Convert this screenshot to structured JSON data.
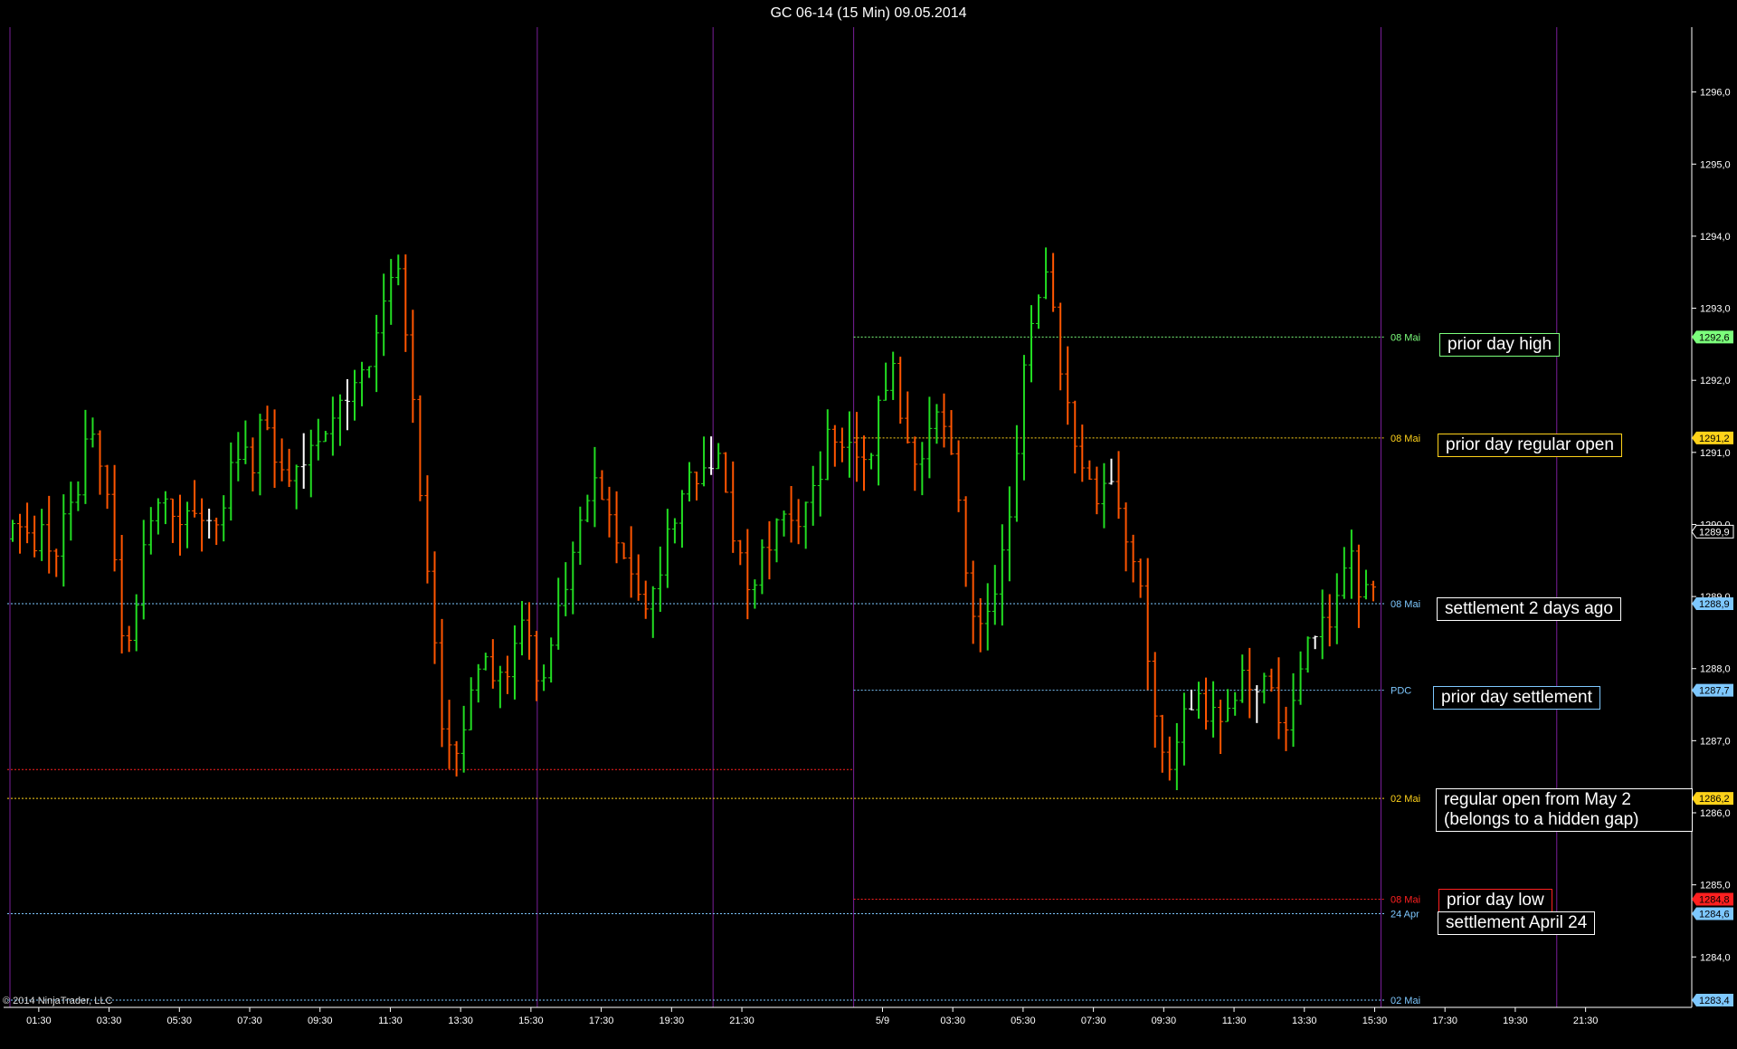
{
  "window": {
    "title": "GC 06-14 (15 Min)  09.05.2014"
  },
  "copyright": "© 2014 NinjaTrader, LLC",
  "colors": {
    "background": "#000000",
    "up_bar": "#22dd22",
    "down_bar": "#ff5500",
    "neutral_bar": "#ffffff",
    "session_line": "#7a1f9a",
    "prior_high": "#7cff7c",
    "regular_open": "#ffd21a",
    "settlement": "#7ec8ff",
    "prior_low": "#ff2020"
  },
  "annotations": [
    {
      "id": "prior-day-high",
      "text": "prior day high",
      "border": "#7cff7c"
    },
    {
      "id": "prior-day-regular-open",
      "text": "prior day regular open",
      "border": "#ffd21a"
    },
    {
      "id": "settlement-2-days-ago",
      "text": "settlement 2 days ago",
      "border": "#ffffff"
    },
    {
      "id": "prior-day-settlement",
      "text": "prior day settlement",
      "border": "#7ec8ff"
    },
    {
      "id": "regular-open-may-2",
      "text": "regular open from May 2\n(belongs to a hidden gap)",
      "border": "#ffffff"
    },
    {
      "id": "prior-day-low",
      "text": "prior day low",
      "border": "#ff2020"
    },
    {
      "id": "settlement-april-24",
      "text": "settlement April 24",
      "border": "#ffffff"
    }
  ],
  "chart_data": {
    "type": "ohlc",
    "title": "GC 06-14 (15 Min)  09.05.2014",
    "ylim": [
      1283.3,
      1296.9
    ],
    "yticks": [
      1284.0,
      1285.0,
      1286.0,
      1287.0,
      1288.0,
      1289.0,
      1290.0,
      1291.0,
      1292.0,
      1293.0,
      1294.0,
      1295.0,
      1296.0
    ],
    "ytick_labels": [
      "1284,0",
      "1285,0",
      "1286,0",
      "1287,0",
      "1288,0",
      "1289,0",
      "1290,0",
      "1291,0",
      "1292,0",
      "1293,0",
      "1294,0",
      "1295,0",
      "1296,0"
    ],
    "xtick_labels": [
      "01:30",
      "03:30",
      "05:30",
      "07:30",
      "09:30",
      "11:30",
      "13:30",
      "15:30",
      "17:30",
      "19:30",
      "21:30",
      "5/9",
      "03:30",
      "05:30",
      "07:30",
      "09:30",
      "11:30",
      "13:30",
      "15:30",
      "17:30",
      "19:30",
      "21:30"
    ],
    "session_separators": [
      0,
      15,
      20,
      24,
      39,
      44
    ],
    "bars_start": 0,
    "bars_end": 47.3,
    "bars": {
      "count": 188,
      "close_path": [
        1289.8,
        1290.0,
        1289.5,
        1289.9,
        1289.6,
        1290.2,
        1290.6,
        1291.6,
        1290.8,
        1289.9,
        1288.2,
        1288.8,
        1289.6,
        1290.2,
        1290.5,
        1290.0,
        1290.1,
        1290.2,
        1290.0,
        1290.2,
        1290.8,
        1291.3,
        1290.8,
        1291.6,
        1291.0,
        1290.6,
        1290.9,
        1290.8,
        1291.1,
        1291.6,
        1291.6,
        1291.9,
        1292.1,
        1292.6,
        1293.4,
        1293.6,
        1292.6,
        1290.6,
        1289.2,
        1287.5,
        1286.6,
        1287.2,
        1287.8,
        1288.2,
        1287.9,
        1287.6,
        1288.4,
        1288.7,
        1287.8,
        1288.2,
        1288.9,
        1289.5,
        1290.2,
        1290.7,
        1290.2,
        1289.6,
        1289.3,
        1288.8,
        1289.1,
        1289.5,
        1289.9,
        1290.3,
        1290.6,
        1290.9,
        1291.0,
        1290.3,
        1289.6,
        1289.1,
        1289.4,
        1289.8,
        1290.2,
        1290.0,
        1289.9,
        1290.5,
        1291.0,
        1291.3,
        1291.0,
        1291.1,
        1291.0,
        1291.8,
        1292.3,
        1291.4,
        1290.8,
        1291.0,
        1291.4,
        1291.5,
        1290.6,
        1289.4,
        1288.4,
        1289.0,
        1289.4,
        1290.1,
        1291.8,
        1293.0,
        1293.8,
        1292.6,
        1291.8,
        1291.1,
        1290.8,
        1290.4,
        1290.9,
        1290.2,
        1289.4,
        1288.8,
        1287.6,
        1286.6,
        1286.9,
        1287.3,
        1287.7,
        1287.4,
        1287.1,
        1287.6,
        1287.8,
        1288.0,
        1287.8,
        1287.4,
        1287.3,
        1287.8,
        1288.3,
        1288.6,
        1288.8,
        1289.1,
        1289.6,
        1289.0,
        1289.1
      ],
      "seed": 2014
    },
    "levels": [
      {
        "name": "prior day high",
        "tag": "08 Mai",
        "value": 1292.6,
        "color": "#7cff7c",
        "x_from": 24,
        "label_text": "1292,6",
        "label_bg": "#7cff7c"
      },
      {
        "name": "prior day regular open",
        "tag": "08 Mai",
        "value": 1291.2,
        "color": "#ffd21a",
        "x_from": 24,
        "label_text": "1291,2",
        "label_bg": "#ffd21a"
      },
      {
        "name": "settlement 2 days ago",
        "tag": "08 Mai",
        "value": 1288.9,
        "color": "#7ec8ff",
        "x_from": 0,
        "label_text": "1288,9",
        "label_bg": "#7ec8ff"
      },
      {
        "name": "prior day settlement",
        "tag": "PDC",
        "value": 1287.7,
        "color": "#7ec8ff",
        "x_from": 24,
        "label_text": "1287,7",
        "label_bg": "#7ec8ff"
      },
      {
        "name": "regular open from May 2",
        "tag": "02 Mai",
        "value": 1286.2,
        "color": "#ffd21a",
        "x_from": 0,
        "label_text": "1286,2",
        "label_bg": "#ffd21a"
      },
      {
        "name": "prior day low",
        "tag": "08 Mai",
        "value": 1284.8,
        "color": "#ff2020",
        "x_from": 24,
        "label_text": "1284,8",
        "label_bg": "#ff2020"
      },
      {
        "name": "settlement April 24",
        "tag": "24 Apr",
        "value": 1284.6,
        "color": "#7ec8ff",
        "x_from": 0,
        "label_text": "1284,6",
        "label_bg": "#7ec8ff"
      },
      {
        "name": "May 2 low",
        "tag": "02 Mai",
        "value": 1283.4,
        "color": "#7ec8ff",
        "x_from": 0,
        "label_text": "1283,4",
        "label_bg": "#7ec8ff"
      }
    ],
    "extra_segments": [
      {
        "value": 1286.6,
        "color": "#ff2020",
        "x_from": 0,
        "x_to": 24
      }
    ],
    "right_tags": [
      {
        "text": "1289,9",
        "value": 1289.9,
        "bg": "#000000",
        "fg": "#ffffff",
        "border": "#ffffff"
      }
    ]
  }
}
